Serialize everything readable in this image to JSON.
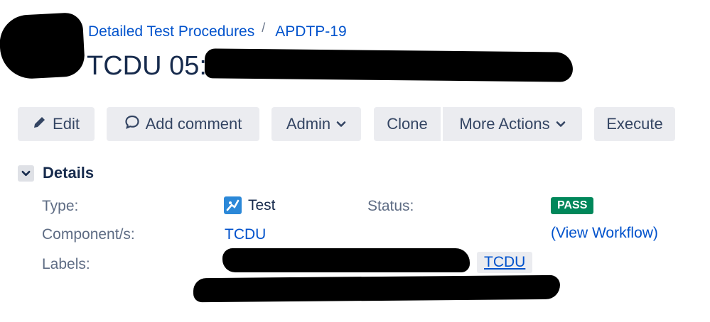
{
  "breadcrumb": {
    "parent": "Detailed Test Procedures",
    "separator": "/",
    "issue_key": "APDTP-19"
  },
  "issue": {
    "title": "TCDU 05:"
  },
  "toolbar": {
    "edit": "Edit",
    "add_comment": "Add comment",
    "admin": "Admin",
    "clone": "Clone",
    "more_actions": "More Actions",
    "execute": "Execute"
  },
  "details": {
    "heading": "Details",
    "type_label": "Type:",
    "type_value": "Test",
    "type_icon": "test-issue-icon",
    "component_label": "Component/s:",
    "component_value": "TCDU",
    "labels_label": "Labels:",
    "label_tag": "TCDU",
    "status_label": "Status:",
    "status_value": "PASS",
    "view_workflow": "(View Workflow)"
  },
  "colors": {
    "link": "#0052cc",
    "button_bg": "#ebecf0",
    "status_pass": "#00875a",
    "text": "#172b4d",
    "muted": "#5e6c84"
  }
}
